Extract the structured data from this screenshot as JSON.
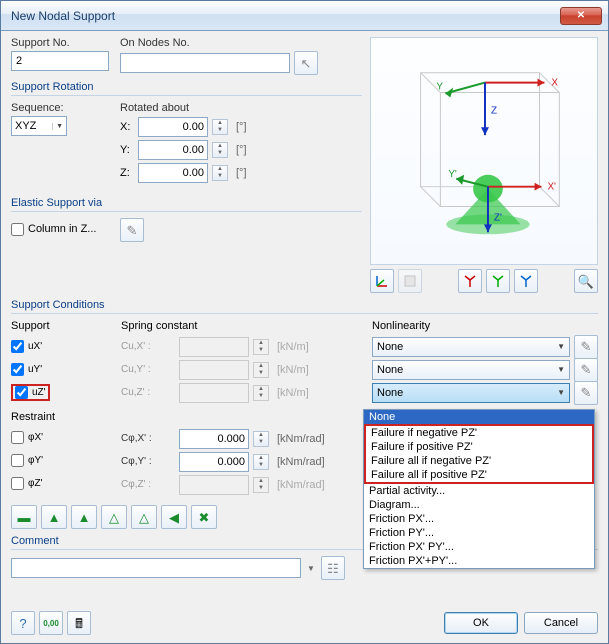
{
  "window": {
    "title": "New Nodal Support"
  },
  "support_no": {
    "label": "Support No.",
    "value": "2"
  },
  "on_nodes": {
    "label": "On Nodes No.",
    "value": ""
  },
  "rotation": {
    "label": "Support Rotation",
    "sequence_label": "Sequence:",
    "sequence_value": "XYZ",
    "rotated_label": "Rotated about",
    "rows": [
      {
        "axis": "X:",
        "value": "0.00",
        "unit": "[°]"
      },
      {
        "axis": "Y:",
        "value": "0.00",
        "unit": "[°]"
      },
      {
        "axis": "Z:",
        "value": "0.00",
        "unit": "[°]"
      }
    ]
  },
  "elastic": {
    "label": "Elastic Support via",
    "column_label": "Column in Z..."
  },
  "conditions": {
    "label": "Support Conditions",
    "support_label": "Support",
    "spring_label": "Spring constant",
    "nonlin_label": "Nonlinearity",
    "restraint_label": "Restraint",
    "supports": [
      {
        "name": "uX'",
        "checked": true
      },
      {
        "name": "uY'",
        "checked": true
      },
      {
        "name": "uZ'",
        "checked": true,
        "highlight": true
      }
    ],
    "restraints": [
      {
        "name": "φX'",
        "checked": false
      },
      {
        "name": "φY'",
        "checked": false
      },
      {
        "name": "φZ'",
        "checked": false
      }
    ],
    "springs_u": [
      {
        "label": "Cu,X' :",
        "value": "",
        "unit": "[kN/m]",
        "disabled": true
      },
      {
        "label": "Cu,Y' :",
        "value": "",
        "unit": "[kN/m]",
        "disabled": true
      },
      {
        "label": "Cu,Z' :",
        "value": "",
        "unit": "[kN/m]",
        "disabled": true
      }
    ],
    "springs_phi": [
      {
        "label": "Cφ,X' :",
        "value": "0.000",
        "unit": "[kNm/rad]",
        "disabled": false
      },
      {
        "label": "Cφ,Y' :",
        "value": "0.000",
        "unit": "[kNm/rad]",
        "disabled": false
      },
      {
        "label": "Cφ,Z' :",
        "value": "",
        "unit": "[kNm/rad]",
        "disabled": true
      }
    ],
    "nonlin_u": [
      {
        "value": "None",
        "open": false
      },
      {
        "value": "None",
        "open": false
      },
      {
        "value": "None",
        "open": true,
        "highlight": true
      }
    ],
    "dropdown_items": [
      {
        "text": "None",
        "selected": true
      },
      {
        "text": "Failure if negative PZ'",
        "group": "hl"
      },
      {
        "text": "Failure if positive PZ'",
        "group": "hl"
      },
      {
        "text": "Failure all if negative PZ'",
        "group": "hl"
      },
      {
        "text": "Failure all if positive PZ'",
        "group": "hl"
      },
      {
        "text": "Partial activity..."
      },
      {
        "text": "Diagram..."
      },
      {
        "text": "Friction PX'..."
      },
      {
        "text": "Friction PY'..."
      },
      {
        "text": "Friction PX' PY'..."
      },
      {
        "text": "Friction PX'+PY'..."
      }
    ]
  },
  "comment": {
    "label": "Comment",
    "value": ""
  },
  "buttons": {
    "ok": "OK",
    "cancel": "Cancel"
  },
  "preview": {
    "axes": {
      "x": "X",
      "y": "Y",
      "z": "Z",
      "xp": "X'",
      "yp": "Y'",
      "zp": "Z'"
    }
  }
}
